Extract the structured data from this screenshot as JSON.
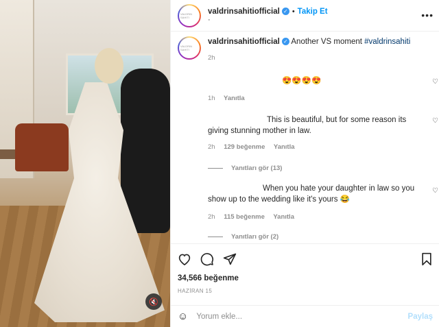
{
  "post": {
    "username": "valdrinsahitiofficial",
    "follow_label": "Takip Et",
    "more_label": "•••",
    "avatar_text": "VALDRIN SAHITI"
  },
  "caption": {
    "username": "valdrinsahitiofficial",
    "text": "Another VS moment",
    "hashtag": "#valdrinsahiti",
    "time": "2h"
  },
  "comments": [
    {
      "text": "😍😍😍😍",
      "time": "1h",
      "likes": "",
      "reply": "Yanıtla"
    },
    {
      "text": "This is beautiful, but for some reason its giving stunning mother in law.",
      "time": "2h",
      "likes": "129 beğenme",
      "reply": "Yanıtla",
      "view_replies": "Yanıtları gör (13)"
    },
    {
      "text": "When you hate your daughter in law so you show up to the wedding like it's yours 😂",
      "time": "2h",
      "likes": "115 beğenme",
      "reply": "Yanıtla",
      "view_replies": "Yanıtları gör (2)"
    }
  ],
  "stats": {
    "likes": "34,566 beğenme",
    "date": "HAZİRAN 15"
  },
  "composer": {
    "placeholder": "Yorum ekle...",
    "post_label": "Paylaş",
    "emoji_icon": "smiley-icon"
  },
  "icons": {
    "verified": "verified-badge-icon",
    "heart": "heart-icon",
    "comment": "comment-icon",
    "share": "share-icon",
    "save": "bookmark-icon",
    "sound": "speaker-muted-icon"
  }
}
